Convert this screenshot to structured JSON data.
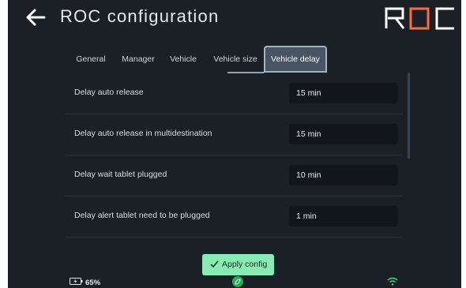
{
  "header": {
    "title": "ROC configuration",
    "logo_text": "ROC",
    "back_icon": "arrow-left-icon"
  },
  "tabs": [
    {
      "label": "General",
      "active": false
    },
    {
      "label": "Manager",
      "active": false
    },
    {
      "label": "Vehicle",
      "active": false
    },
    {
      "label": "Vehicle size",
      "active": false
    },
    {
      "label": "Vehicle delay",
      "active": true
    }
  ],
  "rows": [
    {
      "label": "Delay auto release",
      "value": "15 min"
    },
    {
      "label": "Delay auto release in multidestination",
      "value": "15 min"
    },
    {
      "label": "Delay wait tablet plugged",
      "value": "10 min"
    },
    {
      "label": "Delay alert tablet need to be plugged",
      "value": "1 min"
    }
  ],
  "apply_button": {
    "label": "Apply config",
    "icon": "check-icon"
  },
  "status_bar": {
    "battery_percent": "65%",
    "battery_icon": "battery-charging-icon",
    "center_icon": "leaf-icon",
    "wifi_icon": "wifi-icon"
  },
  "colors": {
    "background": "#1b2027",
    "accent_logo": "#ff6a3d",
    "apply_button": "#87ebb3",
    "status_green": "#3ddc84"
  }
}
